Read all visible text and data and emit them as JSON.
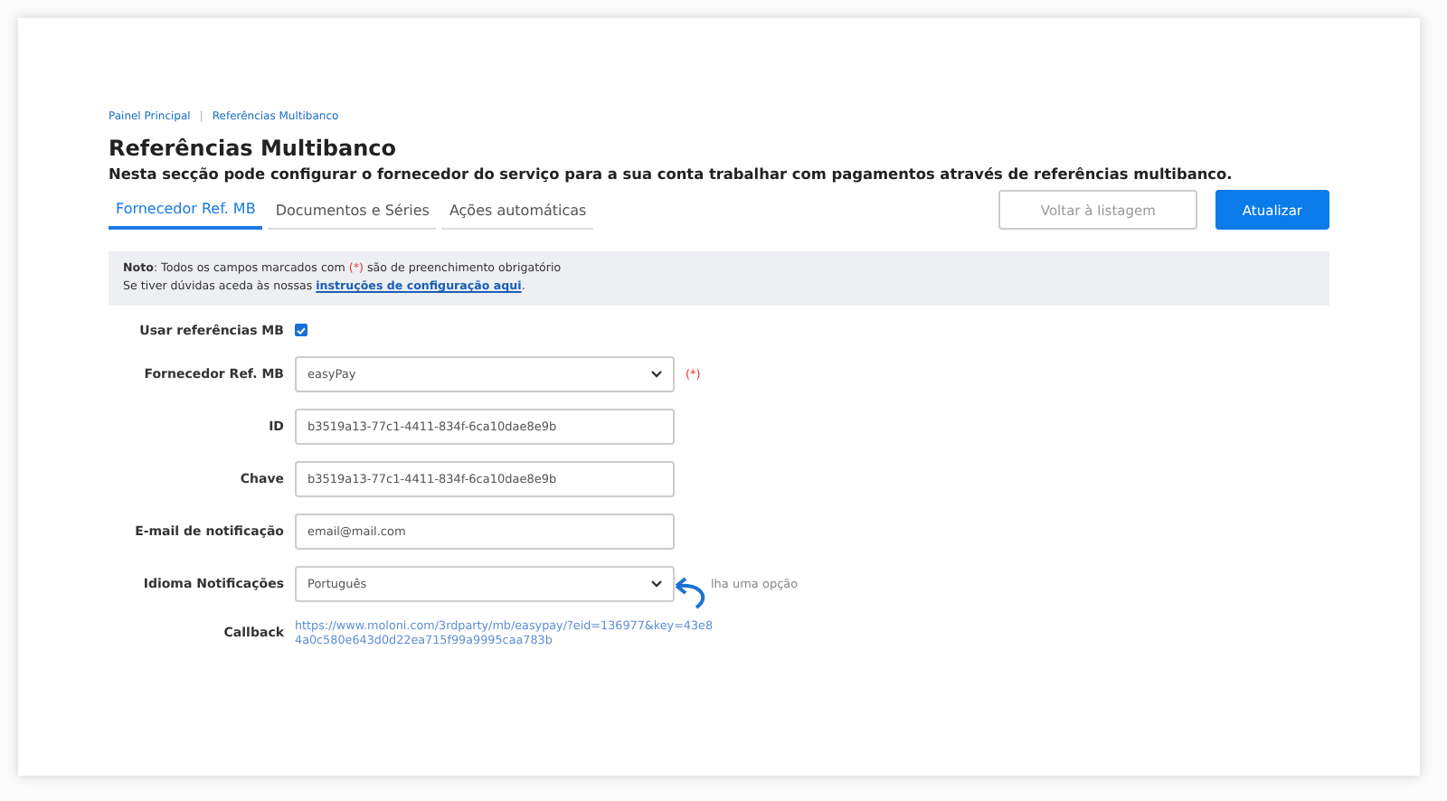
{
  "breadcrumb": [
    "Painel Principal",
    "Referências Multibanco"
  ],
  "breadcrumb_separator": "|",
  "title": "Referências Multibanco",
  "subtitle": "Nesta secção pode configurar o fornecedor do serviço para a sua conta trabalhar com pagamentos através de referências multibanco.",
  "tabs": [
    {
      "label": "Fornecedor Ref. MB",
      "selected": true
    },
    {
      "label": "Documentos e Séries",
      "selected": false
    },
    {
      "label": "Ações automáticas",
      "selected": false
    }
  ],
  "buttons": [
    {
      "label": "Voltar à listagem",
      "kind": "secondary"
    },
    {
      "label": "Atualizar",
      "kind": "primary"
    }
  ],
  "note": {
    "label": "Noto",
    "line1_before": ": Todos os campos marcados com ",
    "required_mark": "(*)",
    "line1_after": " são de preenchimento obrigatório",
    "line2_before": "Se tiver dúvidas aceda às nossas ",
    "link": "instruções de configuração aqui",
    "line2_after": "."
  },
  "fields": [
    {
      "kind": "checkbox",
      "label": "Usar referências MB",
      "checked": true
    },
    {
      "kind": "select",
      "label": "Fornecedor Ref. MB",
      "value": "easyPay",
      "required_mark": "(*)"
    },
    {
      "kind": "input",
      "label": "ID",
      "value": "b3519a13-77c1-4411-834f-6ca10dae8e9b"
    },
    {
      "kind": "input",
      "label": "Chave",
      "value": "b3519a13-77c1-4411-834f-6ca10dae8e9b"
    },
    {
      "kind": "input",
      "label": "E-mail de notificação",
      "value": "email@mail.com"
    },
    {
      "kind": "select",
      "label": "Idioma Notificações",
      "value": "Português",
      "hint": "lha uma opção"
    },
    {
      "kind": "link",
      "label": "Callback",
      "value": "https://www.moloni.com/3rdparty/mb/easypay/?eid=136977&key=43e84a0c580e643d0d22ea715f99a9995caa783b"
    }
  ]
}
